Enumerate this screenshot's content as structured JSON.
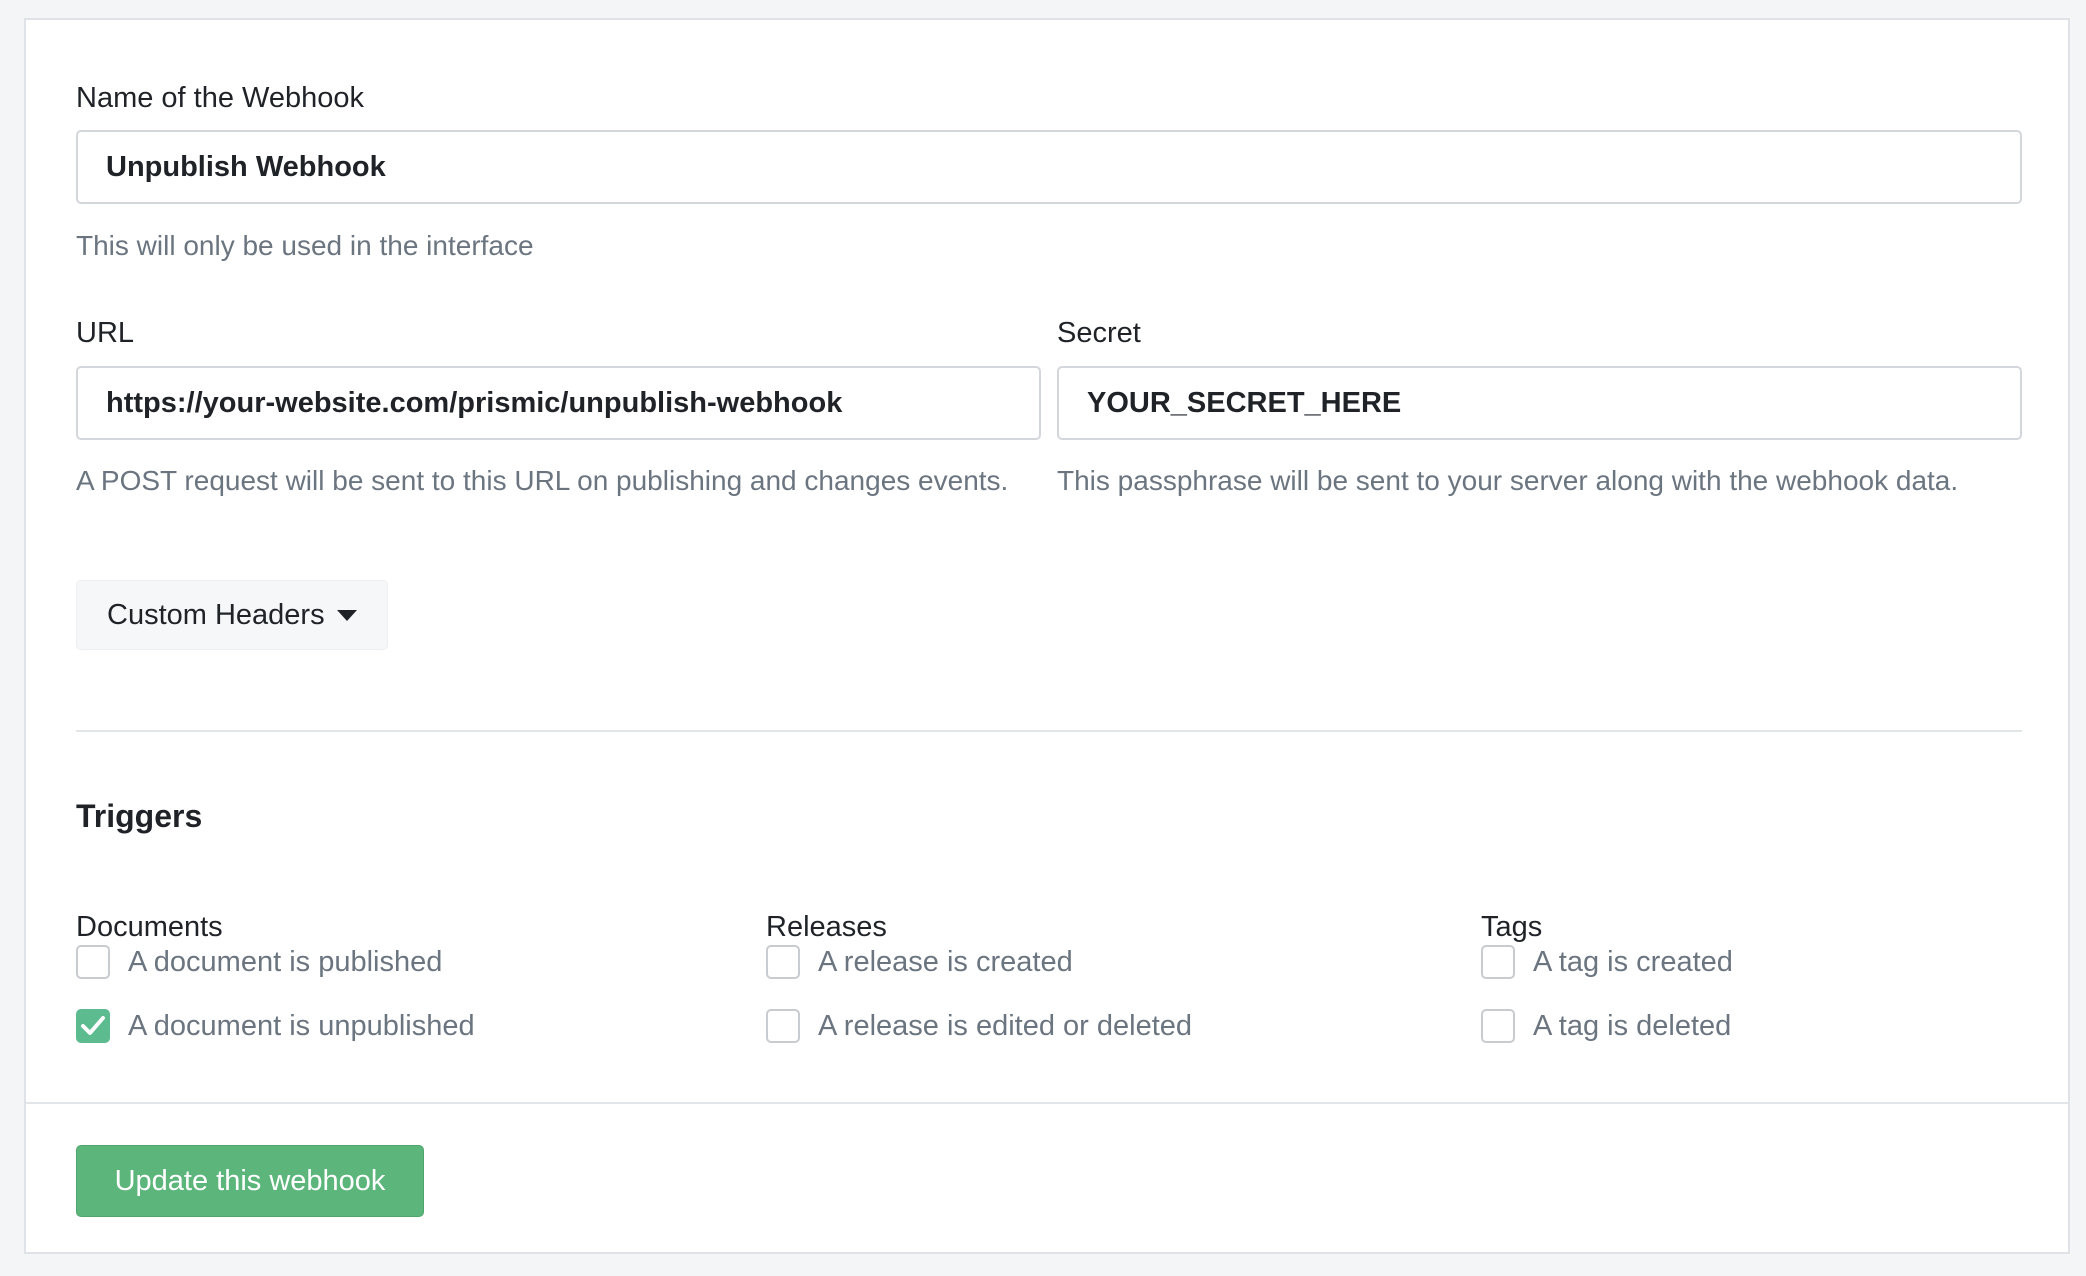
{
  "form": {
    "name": {
      "label": "Name of the Webhook",
      "value": "Unpublish Webhook",
      "help": "This will only be used in the interface"
    },
    "url": {
      "label": "URL",
      "value": "https://your-website.com/prismic/unpublish-webhook",
      "help": "A POST request will be sent to this URL on publishing and changes events."
    },
    "secret": {
      "label": "Secret",
      "value": "YOUR_SECRET_HERE",
      "help": "This passphrase will be sent to your server along with the webhook data."
    },
    "custom_headers_label": "Custom Headers",
    "caret_icon": "caret-down-icon"
  },
  "triggers": {
    "title": "Triggers",
    "groups": [
      {
        "title": "Documents",
        "items": [
          {
            "label": "A document is published",
            "checked": false
          },
          {
            "label": "A document is unpublished",
            "checked": true
          }
        ]
      },
      {
        "title": "Releases",
        "items": [
          {
            "label": "A release is created",
            "checked": false
          },
          {
            "label": "A release is edited or deleted",
            "checked": false
          }
        ]
      },
      {
        "title": "Tags",
        "items": [
          {
            "label": "A tag is created",
            "checked": false
          },
          {
            "label": "A tag is deleted",
            "checked": false
          }
        ]
      }
    ]
  },
  "footer": {
    "submit_label": "Update this webhook"
  },
  "colors": {
    "accent_green": "#5cb57b",
    "checkbox_checked": "#5dbb90",
    "help_text": "#6b7580"
  }
}
